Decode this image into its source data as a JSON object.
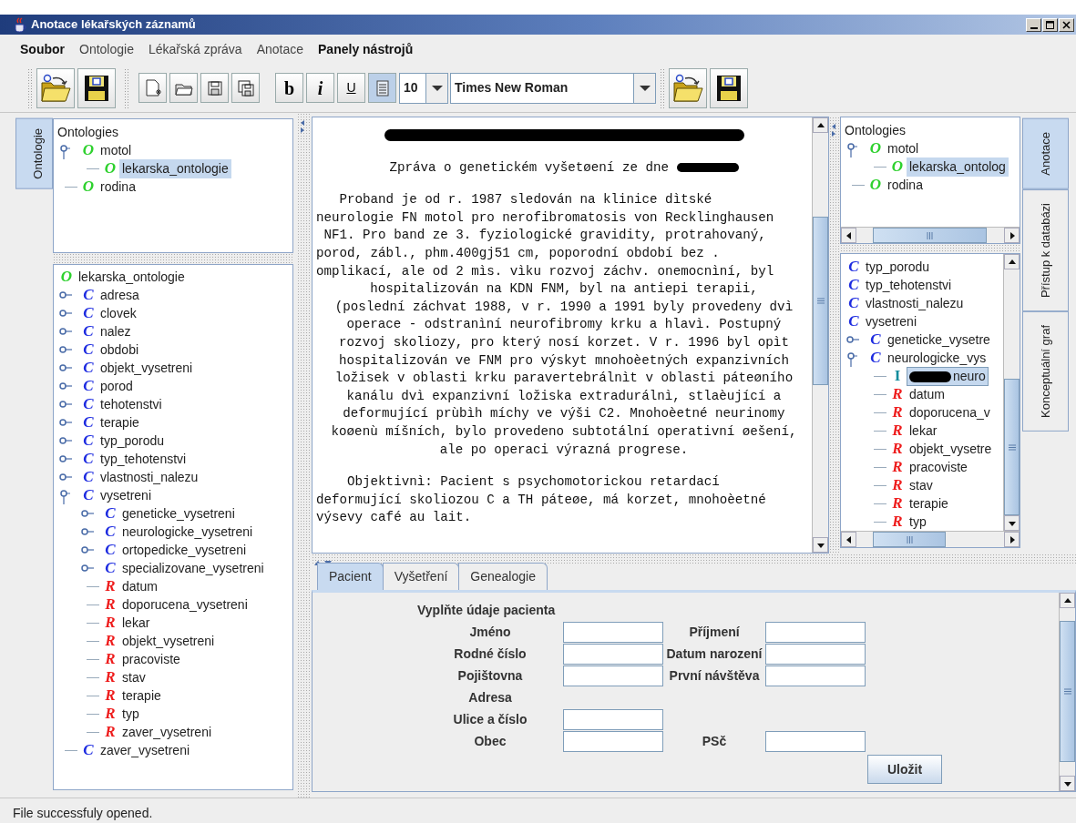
{
  "window": {
    "title": "Anotace lékařských záznamů"
  },
  "menu": [
    {
      "label": "Soubor",
      "disabled": false
    },
    {
      "label": "Ontologie",
      "disabled": true
    },
    {
      "label": "Lékařská zpráva",
      "disabled": true
    },
    {
      "label": "Anotace",
      "disabled": true
    },
    {
      "label": "Panely nástrojů",
      "disabled": false
    }
  ],
  "toolbar": {
    "format_buttons": [
      {
        "label": "b",
        "selected": false
      },
      {
        "label": "i",
        "selected": false
      },
      {
        "label": "U",
        "selected": false
      }
    ],
    "align_toggle": {
      "selected": true
    },
    "font_size": "10",
    "font_name": "Times New Roman"
  },
  "left_tabs": [
    {
      "label": "Ontologie",
      "selected": true
    }
  ],
  "ontology_tree": {
    "root_label": "Ontologies",
    "items": [
      {
        "kind": "ontology",
        "icon": "O",
        "label": "motol",
        "selected": false,
        "expanded": true,
        "children": [
          {
            "kind": "ontology",
            "icon": "O",
            "label": "lekarska_ontologie",
            "selected": true
          }
        ]
      },
      {
        "kind": "ontology",
        "icon": "O",
        "label": "rodina",
        "selected": false
      }
    ]
  },
  "class_tree": {
    "items": [
      {
        "kind": "ontology",
        "icon": "O",
        "label": "lekarska_ontologie",
        "selected": false,
        "children": [
          {
            "kind": "class",
            "icon": "C",
            "label": "adresa",
            "selected": false,
            "expanded": false
          },
          {
            "kind": "class",
            "icon": "C",
            "label": "clovek",
            "selected": false,
            "expanded": false
          },
          {
            "kind": "class",
            "icon": "C",
            "label": "nalez",
            "selected": false,
            "expanded": false
          },
          {
            "kind": "class",
            "icon": "C",
            "label": "obdobi",
            "selected": false,
            "expanded": false
          },
          {
            "kind": "class",
            "icon": "C",
            "label": "objekt_vysetreni",
            "selected": false,
            "expanded": false
          },
          {
            "kind": "class",
            "icon": "C",
            "label": "porod",
            "selected": false,
            "expanded": false
          },
          {
            "kind": "class",
            "icon": "C",
            "label": "tehotenstvi",
            "selected": false,
            "expanded": false
          },
          {
            "kind": "class",
            "icon": "C",
            "label": "terapie",
            "selected": false,
            "expanded": false
          },
          {
            "kind": "class",
            "icon": "C",
            "label": "typ_porodu",
            "selected": false,
            "expanded": false
          },
          {
            "kind": "class",
            "icon": "C",
            "label": "typ_tehotenstvi",
            "selected": false,
            "expanded": false
          },
          {
            "kind": "class",
            "icon": "C",
            "label": "vlastnosti_nalezu",
            "selected": false,
            "expanded": false
          },
          {
            "kind": "class",
            "icon": "C",
            "label": "vysetreni",
            "selected": false,
            "expanded": true,
            "children": [
              {
                "kind": "class",
                "icon": "C",
                "label": "geneticke_vysetreni",
                "selected": false,
                "expanded": false
              },
              {
                "kind": "class",
                "icon": "C",
                "label": "neurologicke_vysetreni",
                "selected": false,
                "expanded": false
              },
              {
                "kind": "class",
                "icon": "C",
                "label": "ortopedicke_vysetreni",
                "selected": false,
                "expanded": false
              },
              {
                "kind": "class",
                "icon": "C",
                "label": "specializovane_vysetreni",
                "selected": false,
                "expanded": false
              },
              {
                "kind": "relation",
                "icon": "R",
                "label": "datum",
                "selected": false
              },
              {
                "kind": "relation",
                "icon": "R",
                "label": "doporucena_vysetreni",
                "selected": false
              },
              {
                "kind": "relation",
                "icon": "R",
                "label": "lekar",
                "selected": false
              },
              {
                "kind": "relation",
                "icon": "R",
                "label": "objekt_vysetreni",
                "selected": false
              },
              {
                "kind": "relation",
                "icon": "R",
                "label": "pracoviste",
                "selected": false
              },
              {
                "kind": "relation",
                "icon": "R",
                "label": "stav",
                "selected": false
              },
              {
                "kind": "relation",
                "icon": "R",
                "label": "terapie",
                "selected": false
              },
              {
                "kind": "relation",
                "icon": "R",
                "label": "typ",
                "selected": false
              },
              {
                "kind": "relation",
                "icon": "R",
                "label": "zaver_vysetreni",
                "selected": false
              }
            ]
          },
          {
            "kind": "class",
            "icon": "C",
            "label": "zaver_vysetreni",
            "selected": false
          }
        ]
      }
    ]
  },
  "report": {
    "paragraphs": [
      {
        "lines": [
          {
            "redacted": true,
            "centered": true
          }
        ]
      },
      {
        "lines": [
          {
            "text": "Zpráva o genetickém vyšetøení ze dne ",
            "redacted": true,
            "centered": true
          }
        ]
      },
      {
        "lines": [
          {
            "text": "   Proband je od r. 1987 sledován na klinice dìtské",
            "centered": false
          },
          {
            "text": "neurologie FN motol pro nerofibromatosis von Recklinghausen",
            "centered": false
          },
          {
            "text": " NF1. Pro band ze 3. fyziologické gravidity, protrahovaný,",
            "centered": false
          },
          {
            "text": "porod, zábl., phm.400gj51 cm, poporodní období bez .",
            "centered": false
          },
          {
            "text": "omplikací, ale od 2 mìs. vìku rozvoj záchv. onemocnìní, byl",
            "centered": false
          },
          {
            "text": "hospitalizován na KDN FNM, byl na antiepi terapii,",
            "centered": true
          },
          {
            "text": "(poslední záchvat 1988, v r. 1990 a 1991 byly provedeny dvì",
            "centered": true
          },
          {
            "text": "operace - odstranìní neurofibromy krku a hlavì. Postupný",
            "centered": true
          },
          {
            "text": "rozvoj skoliozy, pro který nosí korzet. V r. 1996 byl opìt",
            "centered": true
          },
          {
            "text": "hospitalizován ve FNM pro výskyt mnohoèetných expanzivních",
            "centered": true
          },
          {
            "text": "ložisek v oblasti krku paravertebrálnìt v oblasti páteøního",
            "centered": true
          },
          {
            "text": "kanálu dvì expanzivní ložiska extradurálnì, stlaèující a",
            "centered": true
          },
          {
            "text": "deformující prùbìh míchy ve výši C2. Mnohoèetné neurinomy",
            "centered": true
          },
          {
            "text": "koøenù míšních, bylo provedeno subtotální operativní øešení,",
            "centered": true
          },
          {
            "text": "ale po operaci výrazná progrese.",
            "centered": true
          }
        ]
      },
      {
        "lines": [
          {
            "text": "    Objektivnì: Pacient s psychomotorickou retardací",
            "centered": false
          },
          {
            "text": "deformující skoliozou C a TH páteøe, má korzet, mnohoèetné",
            "centered": false
          },
          {
            "text": "výsevy café au lait.",
            "centered": false
          }
        ]
      }
    ]
  },
  "annotation_ontology_tree": {
    "root_label": "Ontologies",
    "items": [
      {
        "kind": "ontology",
        "icon": "O",
        "label": "motol",
        "selected": false,
        "expanded": true,
        "children": [
          {
            "kind": "ontology",
            "icon": "O",
            "label": "lekarska_ontolog",
            "selected": true
          }
        ]
      },
      {
        "kind": "ontology",
        "icon": "O",
        "label": "rodina",
        "selected": false
      }
    ]
  },
  "annotation_class_tree": {
    "items": [
      {
        "kind": "class",
        "icon": "C",
        "label": "typ_porodu",
        "selected": false
      },
      {
        "kind": "class",
        "icon": "C",
        "label": "typ_tehotenstvi",
        "selected": false
      },
      {
        "kind": "class",
        "icon": "C",
        "label": "vlastnosti_nalezu",
        "selected": false
      },
      {
        "kind": "class",
        "icon": "C",
        "label": "vysetreni",
        "selected": false,
        "children": [
          {
            "kind": "class",
            "icon": "C",
            "label": "geneticke_vysetre",
            "selected": false,
            "expanded": false
          },
          {
            "kind": "class",
            "icon": "C",
            "label": "neurologicke_vys",
            "selected": false,
            "expanded": true,
            "children": [
              {
                "kind": "instance",
                "icon": "I",
                "label": "neuro",
                "redacted": true,
                "selected": true
              },
              {
                "kind": "relation",
                "icon": "R",
                "label": "datum",
                "selected": false
              },
              {
                "kind": "relation",
                "icon": "R",
                "label": "doporucena_v",
                "selected": false
              },
              {
                "kind": "relation",
                "icon": "R",
                "label": "lekar",
                "selected": false
              },
              {
                "kind": "relation",
                "icon": "R",
                "label": "objekt_vysetre",
                "selected": false
              },
              {
                "kind": "relation",
                "icon": "R",
                "label": "pracoviste",
                "selected": false
              },
              {
                "kind": "relation",
                "icon": "R",
                "label": "stav",
                "selected": false
              },
              {
                "kind": "relation",
                "icon": "R",
                "label": "terapie",
                "selected": false
              },
              {
                "kind": "relation",
                "icon": "R",
                "label": "typ",
                "selected": false
              }
            ]
          }
        ]
      }
    ]
  },
  "right_tabs": [
    {
      "label": "Anotace",
      "selected": true
    },
    {
      "label": "Přístup k databázi",
      "selected": false
    },
    {
      "label": "Konceptuální graf",
      "selected": false
    }
  ],
  "bottom_tabs": [
    {
      "label": "Pacient",
      "selected": true
    },
    {
      "label": "Vyšetření",
      "selected": false
    },
    {
      "label": "Genealogie",
      "selected": false
    }
  ],
  "patient_form": {
    "title": "Vyplňte údaje pacienta",
    "rows": [
      {
        "kind": "fields",
        "fields": [
          {
            "label": "Jméno"
          },
          {
            "label": "Příjmení"
          }
        ]
      },
      {
        "kind": "fields",
        "fields": [
          {
            "label": "Rodné číslo"
          },
          {
            "label": "Datum narození"
          }
        ]
      },
      {
        "kind": "fields",
        "fields": [
          {
            "label": "Pojištovna"
          },
          {
            "label": "První návštěva"
          }
        ]
      },
      {
        "kind": "heading",
        "label": "Adresa"
      },
      {
        "kind": "fields",
        "fields": [
          {
            "label": "Ulice a číslo"
          }
        ]
      },
      {
        "kind": "fields",
        "fields": [
          {
            "label": "Obec"
          },
          {
            "label": "PSč"
          }
        ]
      }
    ],
    "save_button": "Uložit"
  },
  "status_bar": "File successfuly opened."
}
